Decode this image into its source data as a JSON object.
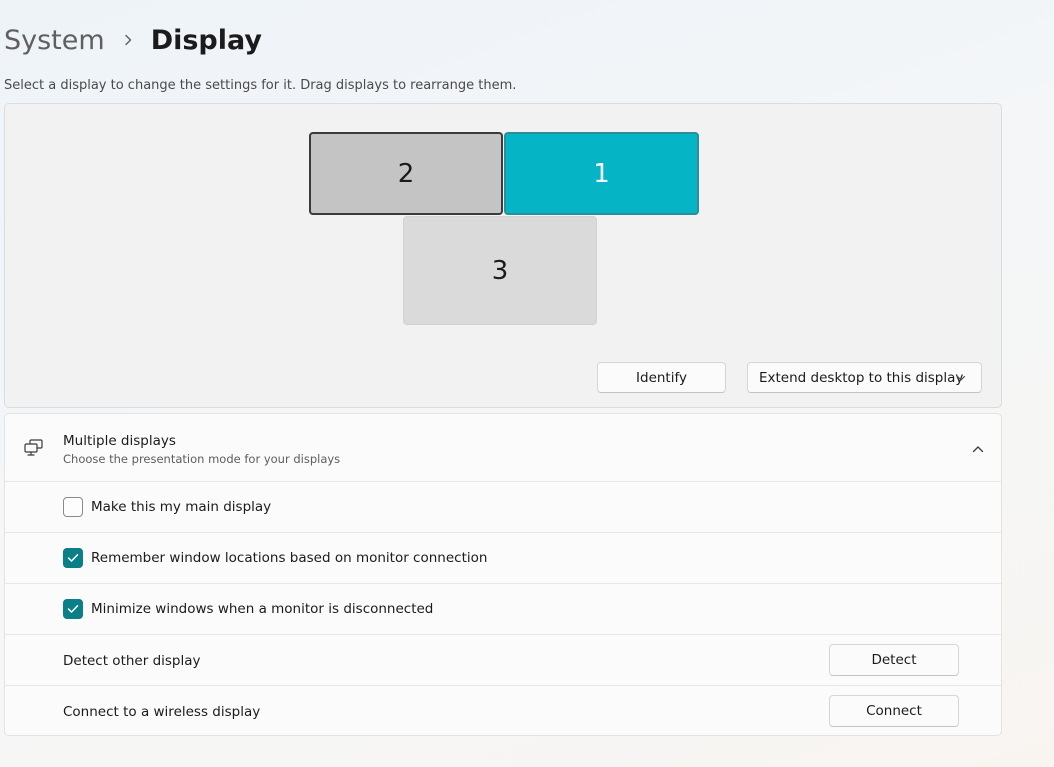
{
  "breadcrumb": {
    "parent": "System",
    "current": "Display"
  },
  "subtitle": "Select a display to change the settings for it. Drag displays to rearrange them.",
  "arrangement": {
    "monitors": [
      {
        "id": "2",
        "selected": false
      },
      {
        "id": "1",
        "selected": true
      },
      {
        "id": "3",
        "selected": false
      }
    ],
    "identify_label": "Identify",
    "mode_select_value": "Extend desktop to this display"
  },
  "multiple_displays": {
    "title": "Multiple displays",
    "description": "Choose the presentation mode for your displays",
    "expanded": true,
    "options": [
      {
        "label": "Make this my main display",
        "checked": false
      },
      {
        "label": "Remember window locations based on monitor connection",
        "checked": true
      },
      {
        "label": "Minimize windows when a monitor is disconnected",
        "checked": true
      }
    ],
    "detect": {
      "label": "Detect other display",
      "button": "Detect"
    },
    "wireless": {
      "label": "Connect to a wireless display",
      "button": "Connect"
    }
  },
  "colors": {
    "accent": "#05b5c5",
    "checkbox_accent": "#0a7f88",
    "panel_bg": "#f2f2f2",
    "card_bg": "#fbfbfb"
  },
  "icons": {
    "breadcrumb_separator": "chevron-right-icon",
    "select_arrow": "chevron-down-icon",
    "multiple_displays": "multiple-displays-icon",
    "collapse": "chevron-up-icon",
    "check": "checkmark-icon"
  }
}
